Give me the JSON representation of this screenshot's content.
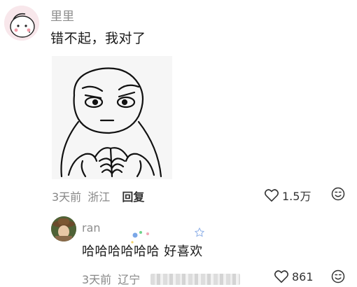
{
  "comment": {
    "username": "里里",
    "text": "错不起，我对了",
    "time": "3天前",
    "location": "浙江",
    "reply_label": "回复",
    "like_count": "1.5万"
  },
  "reply": {
    "username": "ran",
    "text": "哈哈哈哈哈哈 好喜欢",
    "time": "3天前",
    "location": "辽宁",
    "like_count": "861"
  }
}
